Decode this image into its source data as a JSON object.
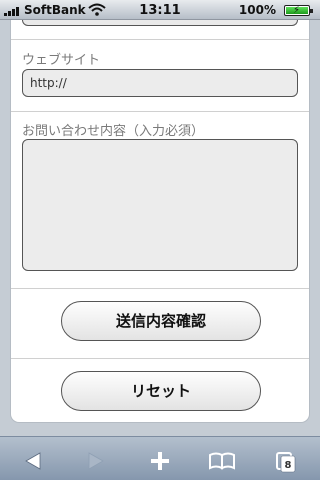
{
  "status_bar": {
    "carrier": "SoftBank",
    "time": "13:11",
    "battery_percent": "100%",
    "icons": [
      "signal-icon",
      "wifi-icon",
      "battery-charging-icon"
    ]
  },
  "form": {
    "website": {
      "label": "ウェブサイト",
      "value": "http://"
    },
    "inquiry": {
      "label": "お問い合わせ内容（入力必須）",
      "value": ""
    },
    "confirm_button_label": "送信内容確認",
    "reset_button_label": "リセット"
  },
  "toolbar": {
    "items": [
      "back-icon",
      "forward-icon",
      "add-icon",
      "bookmarks-icon",
      "pages-icon"
    ],
    "pages_count": "8"
  }
}
